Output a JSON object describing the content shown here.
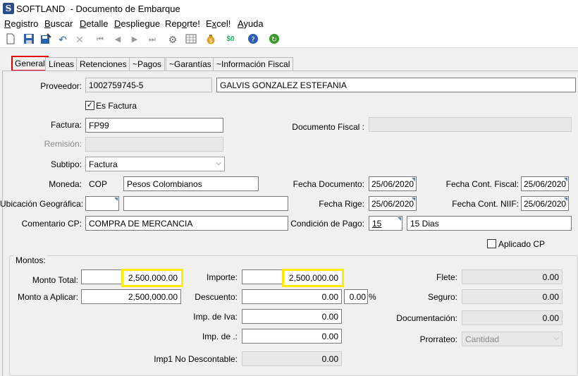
{
  "window": {
    "app_name": "SOFTLAND",
    "title": "- Documento de Embarque"
  },
  "menu": [
    {
      "pre": "",
      "u": "R",
      "post": "egistro"
    },
    {
      "pre": "",
      "u": "B",
      "post": "uscar"
    },
    {
      "pre": "",
      "u": "D",
      "post": "etalle"
    },
    {
      "pre": "",
      "u": "D",
      "post": "espliegue"
    },
    {
      "pre": "Rep",
      "u": "o",
      "post": "rte!"
    },
    {
      "pre": "E",
      "u": "x",
      "post": "cel!"
    },
    {
      "pre": "",
      "u": "A",
      "post": "yuda"
    }
  ],
  "tabs": [
    "General",
    "Líneas",
    "Retenciones",
    "~Pagos",
    "~Garantías",
    "~Información Fiscal"
  ],
  "general": {
    "proveedor_label": "Proveedor:",
    "proveedor_code": "1002759745-5",
    "proveedor_name": "GALVIS GONZALEZ ESTEFANIA",
    "es_factura_label": "Es Factura",
    "es_factura_checked": true,
    "factura_label": "Factura:",
    "factura_value": "FP99",
    "documento_fiscal_label": "Documento Fiscal :",
    "documento_fiscal_value": "",
    "remision_label": "Remisión:",
    "remision_value": "",
    "subtipo_label": "Subtipo:",
    "subtipo_value": "Factura",
    "moneda_label": "Moneda:",
    "moneda_code": "COP",
    "moneda_name": "Pesos Colombianos",
    "fecha_documento_label": "Fecha Documento:",
    "fecha_documento_value": "25/06/2020",
    "fecha_cont_fiscal_label": "Fecha Cont. Fiscal:",
    "fecha_cont_fiscal_value": "25/06/2020",
    "ubicacion_label": "Ubicación Geográfica:",
    "ubicacion_code": "",
    "ubicacion_name": "",
    "fecha_rige_label": "Fecha Rige:",
    "fecha_rige_value": "25/06/2020",
    "fecha_cont_niif_label": "Fecha Cont. NIIF:",
    "fecha_cont_niif_value": "25/06/2020",
    "comentario_label": "Comentario CP:",
    "comentario_value": "COMPRA DE MERCANCIA",
    "condicion_pago_label": "Condición de Pago:",
    "condicion_pago_code": "15",
    "condicion_pago_desc": "15 Dias",
    "aplicado_cp_label": "Aplicado CP",
    "aplicado_cp_checked": false
  },
  "montos": {
    "title": "Montos:",
    "monto_total_label": "Monto Total:",
    "monto_total_value": "2,500,000.00",
    "monto_aplicar_label": "Monto a Aplicar:",
    "monto_aplicar_value": "2,500,000.00",
    "importe_label": "Importe:",
    "importe_value": "2,500,000.00",
    "descuento_label": "Descuento:",
    "descuento_value": "0.00",
    "descuento_pct_value": "0.00",
    "descuento_pct_symbol": "%",
    "imp_iva_label": "Imp. de Iva:",
    "imp_iva_value": "0.00",
    "imp_de_label": "Imp. de .:",
    "imp_de_value": "0.00",
    "imp1_label": "Imp1 No Descontable:",
    "imp1_value": "0.00",
    "flete_label": "Flete:",
    "flete_value": "0.00",
    "seguro_label": "Seguro:",
    "seguro_value": "0.00",
    "documentacion_label": "Documentación:",
    "documentacion_value": "0.00",
    "prorrateo_label": "Prorrateo:",
    "prorrateo_value": "Cantidad"
  },
  "colors": {
    "highlight_tab": "#e00000",
    "highlight_amount": "#ffeb00"
  }
}
